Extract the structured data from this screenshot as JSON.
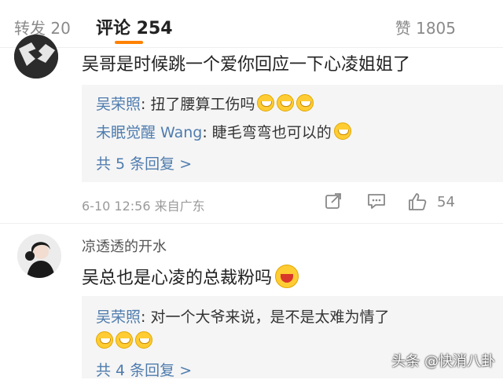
{
  "tabs": {
    "repost": "转发 20",
    "comments": "评论 254",
    "likes": "赞 1805"
  },
  "comment1": {
    "text": "吴哥是时候跳一个爱你回应一下心凌姐姐了",
    "replies": [
      {
        "name": "吴荣照",
        "text": ": 扭了腰算工伤吗",
        "emoji_count": 3
      },
      {
        "name": "未眠觉醒 Wang",
        "text": ": 睫毛弯弯也可以的",
        "emoji_count": 1
      }
    ],
    "more_replies": "共 5 条回复 >",
    "meta": "6-10 12:56  来自广东",
    "like_count": "54"
  },
  "comment2": {
    "username": "凉透透的开水",
    "text": "吴总也是心凌的总裁粉吗",
    "replies": [
      {
        "name": "吴荣照",
        "text": ": 对一个大爷来说，是不是太难为情了",
        "emoji_count": 3
      }
    ],
    "more_replies": "共 4 条回复 >"
  },
  "watermark": "头条 @快消八卦",
  "colors": {
    "accent": "#ff8200",
    "link": "#4f7cae",
    "muted": "#9a9a9a",
    "reply_bg": "#f5f5f5"
  },
  "icons": [
    "share-icon",
    "comment-icon",
    "thumbs-up-icon",
    "laugh-emoji-icon"
  ]
}
